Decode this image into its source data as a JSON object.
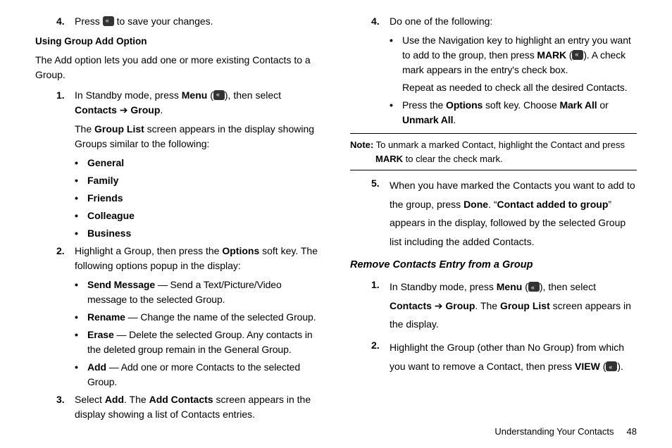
{
  "footer": {
    "label": "Understanding Your Contacts",
    "page": "48"
  },
  "section1": {
    "step4": {
      "num": "4.",
      "pre": "Press ",
      "post": " to save your changes."
    }
  },
  "usingGroup": {
    "heading": "Using Group Add Option",
    "intro": "The Add option lets you add one or more existing Contacts to a Group.",
    "step1": {
      "num": "1.",
      "pre": "In Standby mode, press ",
      "menu": "Menu",
      "mid": " (",
      "mid2": "), then select ",
      "contacts": "Contacts",
      "arrow": " ➔ ",
      "group": "Group",
      "dot": ".",
      "line2a": "The ",
      "line2b": "Group List",
      "line2c": " screen appears in the display showing Groups similar to the following:",
      "bullets": [
        "General",
        "Family",
        "Friends",
        "Colleague",
        "Business"
      ]
    },
    "step2": {
      "num": "2.",
      "pre": "Highlight a Group, then press the ",
      "opt": "Options",
      "post": " soft key. The following options popup in the display:",
      "opts": [
        {
          "name": "Send Message",
          "desc": " — Send a Text/Picture/Video message to the selected Group."
        },
        {
          "name": "Rename",
          "desc": " — Change the name of the selected Group."
        },
        {
          "name": "Erase",
          "desc": " — Delete the selected Group. Any contacts in the deleted group remain in the General Group."
        },
        {
          "name": "Add",
          "desc": " — Add one or more Contacts to the selected Group."
        }
      ]
    },
    "step3": {
      "num": "3.",
      "pre": "Select ",
      "add": "Add",
      "mid": ". The ",
      "ac": "Add Contacts",
      "post": " screen appears in the display showing a list of Contacts entries."
    },
    "step4": {
      "num": "4.",
      "text": "Do one of the following:",
      "b1a": "Use the Navigation key to highlight an entry you want to add to the group, then press ",
      "b1mark": "MARK",
      "b1b": " (",
      "b1c": "). A check mark appears in the entry's check box.",
      "b1repeat": "Repeat as needed to check all the desired Contacts.",
      "b2a": "Press the ",
      "b2opt": "Options",
      "b2b": " soft key. Choose ",
      "b2ma": "Mark All",
      "b2c": " or ",
      "b2ua": "Unmark All",
      "b2d": "."
    },
    "note": {
      "label": "Note:",
      "a": " To unmark a marked Contact, highlight the Contact and press ",
      "mark": "MARK",
      "b": " to clear the check mark."
    },
    "step5": {
      "num": "5.",
      "a": "When you have marked the Contacts you want to add to the group, press ",
      "done": "Done",
      "b": ". “",
      "msg": "Contact added to group",
      "c": "” appears in the display, followed by the selected Group list including the added Contacts."
    }
  },
  "remove": {
    "heading": "Remove Contacts Entry from a Group",
    "step1": {
      "num": "1.",
      "pre": "In Standby mode, press ",
      "menu": "Menu",
      "a": " (",
      "b": "), then select ",
      "contacts": "Contacts",
      "arrow": " ➔ ",
      "group": "Group",
      "c": ". The ",
      "gl": "Group List",
      "d": " screen appears in the display."
    },
    "step2": {
      "num": "2.",
      "a": "Highlight the Group (other than No Group) from which you want to remove a Contact, then press ",
      "view": "VIEW",
      "b": " (",
      "c": ")."
    }
  }
}
